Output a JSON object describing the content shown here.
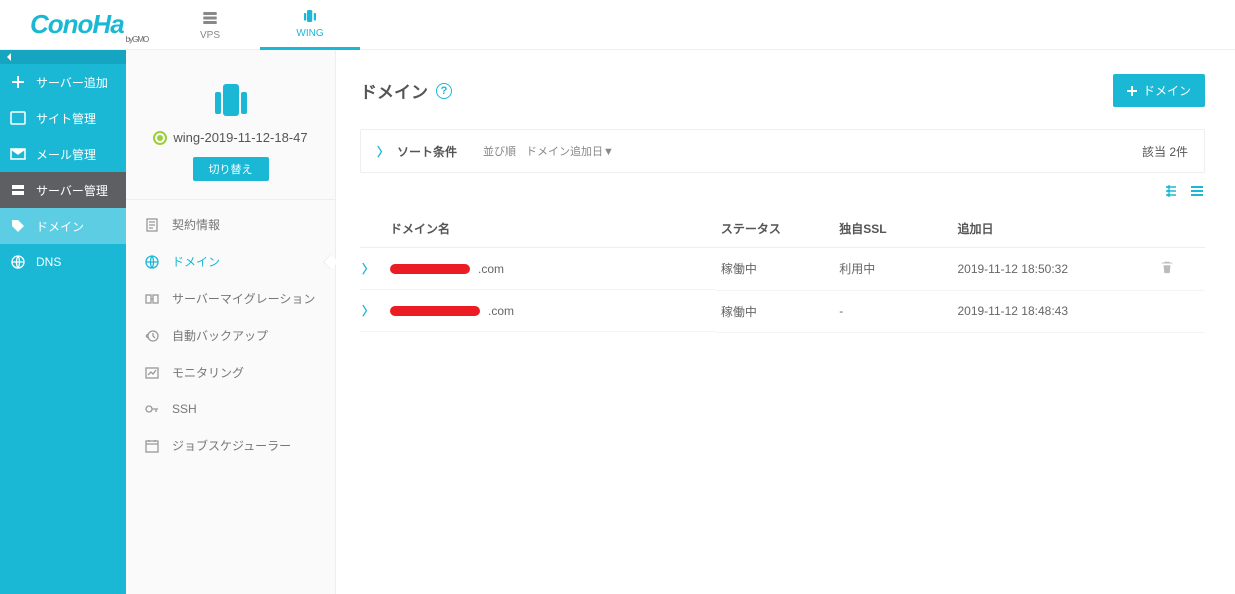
{
  "brand": {
    "name": "ConoHa",
    "sub": "byGMO"
  },
  "topnav": {
    "vps": "VPS",
    "wing": "WING"
  },
  "sidebar": {
    "add_server": "サーバー追加",
    "site_mgmt": "サイト管理",
    "mail_mgmt": "メール管理",
    "server_mgmt": "サーバー管理",
    "domain": "ドメイン",
    "dns": "DNS"
  },
  "subpanel": {
    "server_name": "wing-2019-11-12-18-47",
    "switch_label": "切り替え",
    "items": {
      "contract": "契約情報",
      "domain": "ドメイン",
      "migration": "サーバーマイグレーション",
      "backup": "自動バックアップ",
      "monitoring": "モニタリング",
      "ssh": "SSH",
      "scheduler": "ジョブスケジューラー"
    }
  },
  "page": {
    "title": "ドメイン",
    "add_button": "ドメイン",
    "filter_label": "ソート条件",
    "sort_key": "並び順",
    "sort_value": "ドメイン追加日▼",
    "count": "該当 2件"
  },
  "table": {
    "headers": {
      "domain": "ドメイン名",
      "status": "ステータス",
      "ssl": "独自SSL",
      "added": "追加日"
    },
    "rows": [
      {
        "domain_suffix": ".com",
        "status": "稼働中",
        "ssl": "利用中",
        "added": "2019-11-12 18:50:32",
        "deletable": true
      },
      {
        "domain_suffix": ".com",
        "status": "稼働中",
        "ssl": "-",
        "added": "2019-11-12 18:48:43",
        "deletable": false
      }
    ]
  }
}
